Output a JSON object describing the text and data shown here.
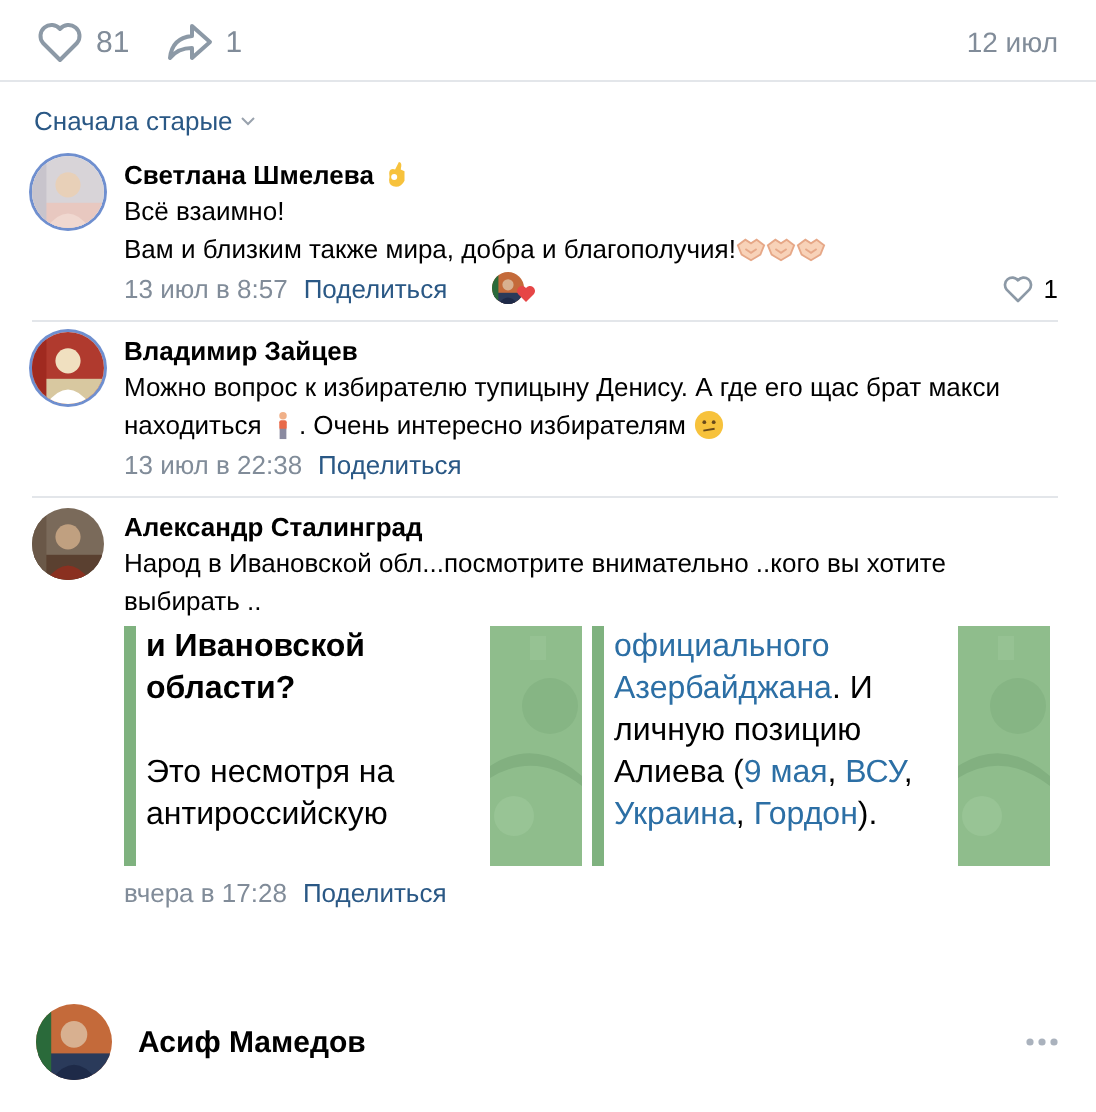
{
  "post_footer": {
    "likes": "81",
    "shares": "1",
    "date": "12 июл"
  },
  "sort": {
    "label": "Сначала старые"
  },
  "comments": [
    {
      "author": [
        {
          "kind": "text",
          "text": "Светлана Шмелева"
        },
        {
          "kind": "ok-hand"
        }
      ],
      "lines": [
        [
          {
            "kind": "text",
            "text": "Всё взаимно!"
          }
        ],
        [
          {
            "kind": "text",
            "text": "Вам и близким также мира, добра и благополучия!"
          },
          {
            "kind": "handshake"
          },
          {
            "kind": "handshake"
          },
          {
            "kind": "handshake"
          }
        ]
      ],
      "time": "13 июл в 8:57",
      "share": "Поделиться",
      "reactor": true,
      "likes": "1"
    },
    {
      "author": [
        {
          "kind": "text",
          "text": "Владимир Зайцев"
        }
      ],
      "lines": [
        [
          {
            "kind": "text",
            "text": "Можно вопрос к избирателю тупицыну Денису. А где его щас брат макси"
          }
        ],
        [
          {
            "kind": "text",
            "text": "находиться "
          },
          {
            "kind": "person"
          },
          {
            "kind": "text",
            "text": ". Очень интересно избирателям "
          },
          {
            "kind": "thinking"
          }
        ]
      ],
      "time": "13 июл в 22:38",
      "share": "Поделиться",
      "reactor": false
    },
    {
      "author": [
        {
          "kind": "text",
          "text": "Александр Сталинград"
        }
      ],
      "lines": [
        [
          {
            "kind": "text",
            "text": "Народ в Ивановской обл...посмотрите внимательно ..кого вы хотите"
          }
        ],
        [
          {
            "kind": "text",
            "text": "выбирать .."
          }
        ]
      ],
      "time": "вчера в 17:28",
      "share": "Поделиться",
      "reactor": false,
      "attachment": {
        "panels": [
          {
            "paragraphs": [
              {
                "bold": true,
                "lines": [
                  [
                    {
                      "text": "и Ивановской",
                      "link": false
                    }
                  ],
                  [
                    {
                      "text": "области?",
                      "link": false
                    }
                  ]
                ]
              },
              {
                "bold": false,
                "lines": [
                  [
                    {
                      "text": "Это несмотря на",
                      "link": false
                    }
                  ],
                  [
                    {
                      "text": "антироссийскую",
                      "link": false
                    }
                  ]
                ]
              }
            ]
          },
          {
            "paragraphs": [
              {
                "bold": false,
                "lines": [
                  [
                    {
                      "text": "официального",
                      "link": true
                    }
                  ],
                  [
                    {
                      "text": "Азербайджана",
                      "link": true
                    },
                    {
                      "text": ". И",
                      "link": false
                    }
                  ],
                  [
                    {
                      "text": "личную позицию",
                      "link": false
                    }
                  ],
                  [
                    {
                      "text": "Алиева (",
                      "link": false
                    },
                    {
                      "text": "9 мая",
                      "link": true
                    },
                    {
                      "text": ", ",
                      "link": false
                    },
                    {
                      "text": "ВСУ",
                      "link": true
                    },
                    {
                      "text": ",",
                      "link": false
                    }
                  ],
                  [
                    {
                      "text": "Украина",
                      "link": true
                    },
                    {
                      "text": ", ",
                      "link": false
                    },
                    {
                      "text": "Гордон",
                      "link": true
                    },
                    {
                      "text": ").",
                      "link": false
                    }
                  ]
                ]
              }
            ]
          }
        ]
      }
    }
  ],
  "next_post": {
    "author": "Асиф Мамедов"
  }
}
